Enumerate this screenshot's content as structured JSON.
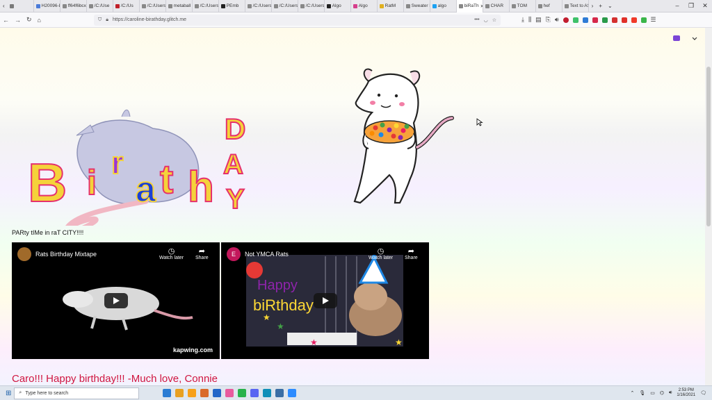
{
  "browser": {
    "tabs": [
      {
        "label": "",
        "color": "#7a7a7a"
      },
      {
        "label": "H20096-L",
        "color": "#4b7bd8"
      },
      {
        "label": "ff64f6bcx",
        "color": "#888888"
      },
      {
        "label": "/C:/Use",
        "color": "#888888"
      },
      {
        "label": "/C:/Us",
        "color": "#c0202a"
      },
      {
        "label": "/C:/Users",
        "color": "#888888"
      },
      {
        "label": "metaball",
        "color": "#888888"
      },
      {
        "label": "/C:/Users",
        "color": "#888888"
      },
      {
        "label": "PEmb",
        "color": "#222222"
      },
      {
        "label": "/C:/Users",
        "color": "#888888"
      },
      {
        "label": "/C:/Users",
        "color": "#888888"
      },
      {
        "label": "/C:/Users",
        "color": "#888888"
      },
      {
        "label": "Algo",
        "color": "#222222"
      },
      {
        "label": "Algo",
        "color": "#d63e8c"
      },
      {
        "label": "RatM",
        "color": "#e0b020"
      },
      {
        "label": "Sweater R",
        "color": "#888888"
      },
      {
        "label": "algo",
        "color": "#1da1f2"
      },
      {
        "label": "biRaTh",
        "color": "#888888",
        "active": true
      },
      {
        "label": "CHAR",
        "color": "#888888"
      },
      {
        "label": "TOM",
        "color": "#888888"
      },
      {
        "label": "hef",
        "color": "#888888"
      },
      {
        "label": "Text to AS",
        "color": "#888888"
      }
    ],
    "close_glyph": "✕",
    "new_tab_glyph": "+",
    "url": "https://caroline-birathday.glitch.me"
  },
  "page": {
    "tagline": "PARty tIMe in raT CITY!!!!",
    "message": "Caro!!! Happy birthday!!! -Much love, Connie",
    "title_letters": [
      "B",
      "i",
      "r",
      "a",
      "t",
      "h",
      "D",
      "A",
      "Y"
    ]
  },
  "videos": [
    {
      "title": "Rats Birthday Mixtape",
      "watch_later": "Watch later",
      "share": "Share",
      "brand": "kapwing.com",
      "channel_color": "#a06a2a",
      "channel_letter": ""
    },
    {
      "title": "Not YMCA Rats",
      "watch_later": "Watch later",
      "share": "Share",
      "brand": "",
      "channel_color": "#c2185b",
      "channel_letter": "E"
    }
  ],
  "taskbar": {
    "search_placeholder": "Type here to search",
    "time": "2:53 PM",
    "date": "1/16/2021",
    "apps": [
      "#2b7cd3",
      "#e8a020",
      "#f7a11a",
      "#d96a2a",
      "#2266c8",
      "#e85b9e",
      "#27b24a",
      "#5865f2",
      "#0f8fb8",
      "#3a6ea5",
      "#2d8cff"
    ]
  },
  "colors": {
    "accent_red": "#d01640",
    "title_yellow": "#f5d23a",
    "title_red": "#e5306d",
    "title_purple": "#9a35d6",
    "title_blue": "#1a3fd6"
  }
}
